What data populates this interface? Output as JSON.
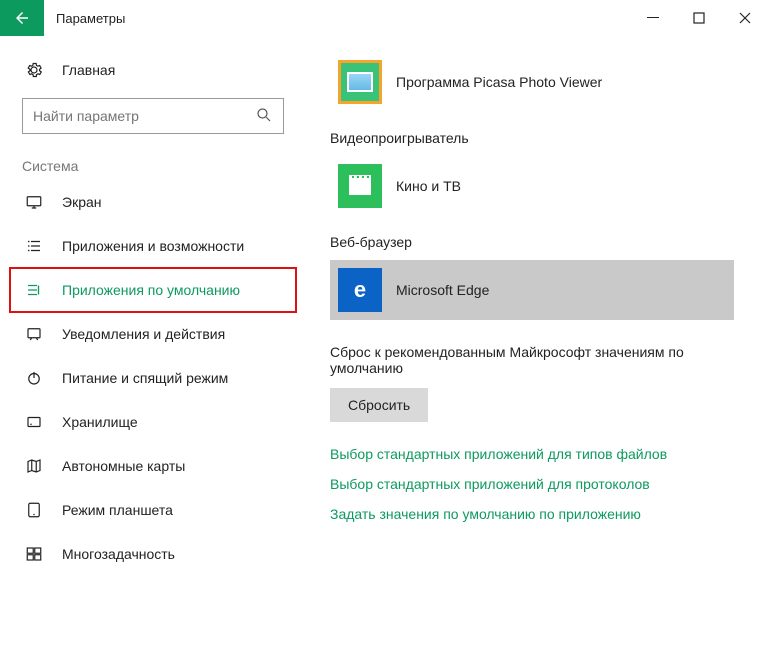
{
  "window": {
    "title": "Параметры"
  },
  "search": {
    "placeholder": "Найти параметр"
  },
  "home": {
    "label": "Главная"
  },
  "section": {
    "label": "Система"
  },
  "sidebar": {
    "items": [
      {
        "label": "Экран"
      },
      {
        "label": "Приложения и возможности"
      },
      {
        "label": "Приложения по умолчанию"
      },
      {
        "label": "Уведомления и действия"
      },
      {
        "label": "Питание и спящий режим"
      },
      {
        "label": "Хранилище"
      },
      {
        "label": "Автономные карты"
      },
      {
        "label": "Режим планшета"
      },
      {
        "label": "Многозадачность"
      }
    ]
  },
  "main": {
    "photoApp": "Программа Picasa Photo Viewer",
    "videoPlayerTitle": "Видеопроигрыватель",
    "videoApp": "Кино и ТВ",
    "browserTitle": "Веб-браузер",
    "browserApp": "Microsoft Edge",
    "resetText": "Сброс к рекомендованным Майкрософт значениям по умолчанию",
    "resetButton": "Сбросить",
    "link1": "Выбор стандартных приложений для типов файлов",
    "link2": "Выбор стандартных приложений для протоколов",
    "link3": "Задать значения по умолчанию по приложению"
  }
}
